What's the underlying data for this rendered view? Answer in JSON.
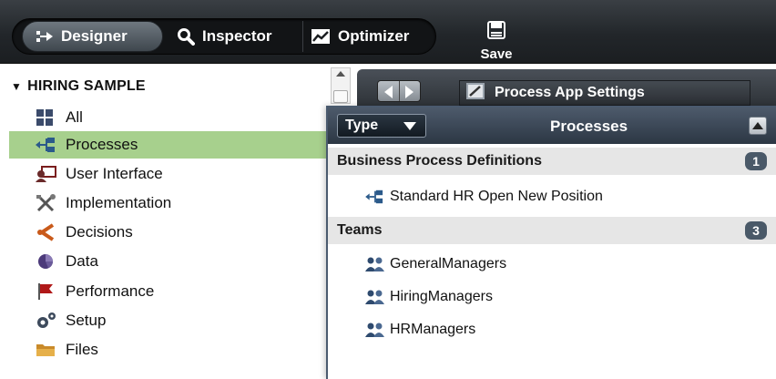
{
  "toolbar": {
    "tabs": [
      {
        "label": "Designer",
        "icon": "designer-icon",
        "active": true
      },
      {
        "label": "Inspector",
        "icon": "magnifier-icon",
        "active": false
      },
      {
        "label": "Optimizer",
        "icon": "chart-icon",
        "active": false
      }
    ],
    "save_label": "Save"
  },
  "library": {
    "header": "HIRING SAMPLE",
    "items": [
      {
        "label": "All",
        "icon": "grid-icon",
        "selected": false
      },
      {
        "label": "Processes",
        "icon": "process-icon",
        "selected": true
      },
      {
        "label": "User Interface",
        "icon": "user-interface-icon",
        "selected": false
      },
      {
        "label": "Implementation",
        "icon": "tools-icon",
        "selected": false
      },
      {
        "label": "Decisions",
        "icon": "decision-icon",
        "selected": false
      },
      {
        "label": "Data",
        "icon": "data-icon",
        "selected": false
      },
      {
        "label": "Performance",
        "icon": "flag-icon",
        "selected": false
      },
      {
        "label": "Setup",
        "icon": "gears-icon",
        "selected": false
      },
      {
        "label": "Files",
        "icon": "folder-icon",
        "selected": false
      }
    ]
  },
  "editor": {
    "tab_label": "Process App Settings"
  },
  "popup": {
    "type_label": "Type",
    "title": "Processes",
    "sections": [
      {
        "label": "Business Process Definitions",
        "count": "1",
        "entries": [
          {
            "label": "Standard HR Open New Position",
            "icon": "process-icon"
          }
        ]
      },
      {
        "label": "Teams",
        "count": "3",
        "entries": [
          {
            "label": "GeneralManagers",
            "icon": "team-icon"
          },
          {
            "label": "HiringManagers",
            "icon": "team-icon"
          },
          {
            "label": "HRManagers",
            "icon": "team-icon"
          }
        ]
      }
    ]
  },
  "colors": {
    "selected_row": "#a7d08d",
    "badge": "#4a5968",
    "header_dark": "#2c3744"
  }
}
